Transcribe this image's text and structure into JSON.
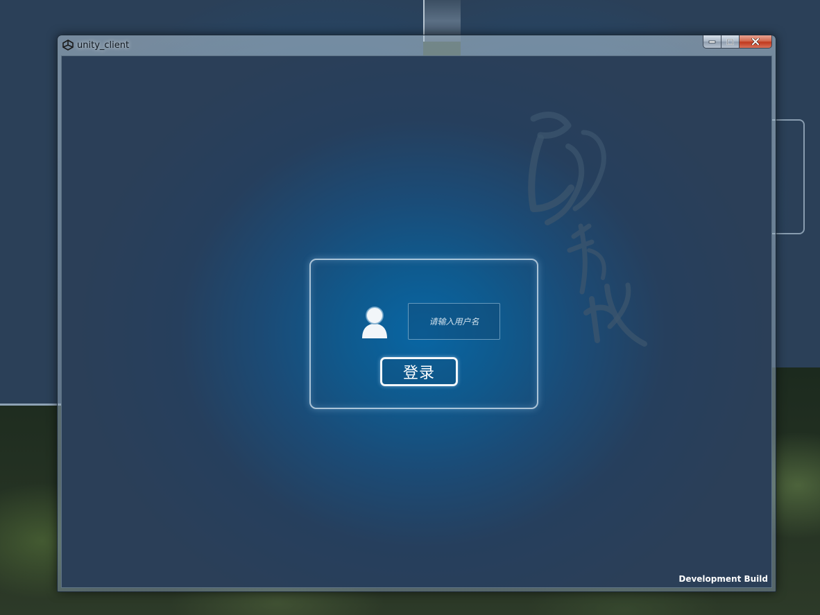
{
  "window": {
    "title": "unity_client",
    "icon": "unity-logo-icon"
  },
  "caption_buttons": {
    "minimize_icon": "minimize-icon",
    "maximize_icon": "maximize-icon",
    "close_icon": "close-icon"
  },
  "login": {
    "username_placeholder": "请输入用户名",
    "username_value": "",
    "login_label": "登录",
    "user_icon": "user-avatar-icon"
  },
  "footer": {
    "build_label": "Development Build"
  },
  "colors": {
    "background_center": "#0866a4",
    "background_edge": "#2b3f58",
    "panel_border": "#dcebf5",
    "button_border": "#f3f7fa",
    "close_button": "#c0391e"
  }
}
